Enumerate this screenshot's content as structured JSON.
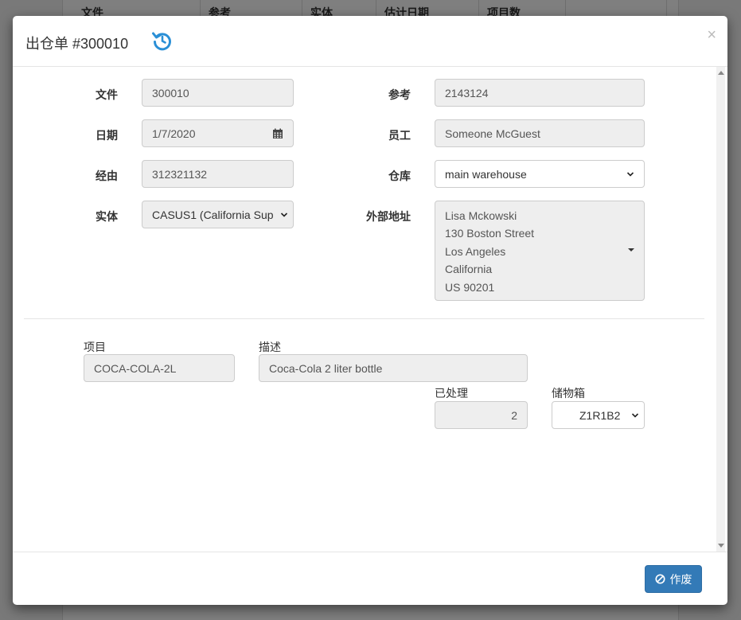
{
  "background": {
    "table_headers": [
      "文件",
      "参考",
      "实体",
      "估计日期",
      "项目数",
      ""
    ]
  },
  "modal": {
    "title": "出仓单 #300010",
    "close_label": "×",
    "fields": {
      "document": {
        "label": "文件",
        "value": "300010"
      },
      "reference": {
        "label": "参考",
        "value": "2143124"
      },
      "date": {
        "label": "日期",
        "value": "1/7/2020"
      },
      "employee": {
        "label": "员工",
        "value": "Someone McGuest"
      },
      "via": {
        "label": "经由",
        "value": "312321132"
      },
      "warehouse": {
        "label": "仓库",
        "value": "main warehouse"
      },
      "entity": {
        "label": "实体",
        "value": "CASUS1 (California Sup"
      },
      "external_address": {
        "label": "外部地址",
        "lines": [
          "Lisa Mckowski",
          "130 Boston Street",
          "Los Angeles",
          "California",
          "US 90201"
        ]
      }
    },
    "line_item": {
      "item_label": "项目",
      "item_value": "COCA-COLA-2L",
      "description_label": "描述",
      "description_value": "Coca-Cola 2 liter bottle",
      "processed_label": "已处理",
      "processed_value": "2",
      "bin_label": "储物箱",
      "bin_value": "Z1R1B2"
    },
    "footer": {
      "void_label": "作废"
    }
  },
  "colors": {
    "primary": "#337ab7",
    "history_icon": "#2a8fd6"
  }
}
